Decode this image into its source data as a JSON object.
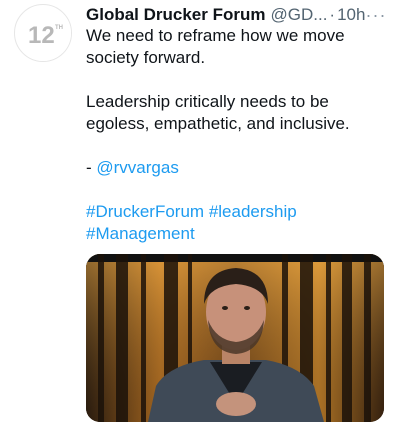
{
  "account": {
    "display_name": "Global Drucker Forum",
    "handle": "@GD...",
    "separator": "·",
    "time": "10h",
    "more_label": "···",
    "avatar_text": "12",
    "avatar_superscript": "TH"
  },
  "tweet": {
    "line1": "We need to reframe how we move",
    "line2": "society forward.",
    "line3": "Leadership critically needs to be",
    "line4": "egoless, empathetic, and inclusive.",
    "mention_prefix": "- ",
    "mention": "@rvvargas",
    "hashtag1": "#DruckerForum",
    "hashtag2": "#leadership",
    "hashtag3": "#Management"
  },
  "colors": {
    "text": "#0f1419",
    "secondary": "#536471",
    "link": "#1d9bf0"
  },
  "media": {
    "description_icon": "video-thumbnail"
  }
}
